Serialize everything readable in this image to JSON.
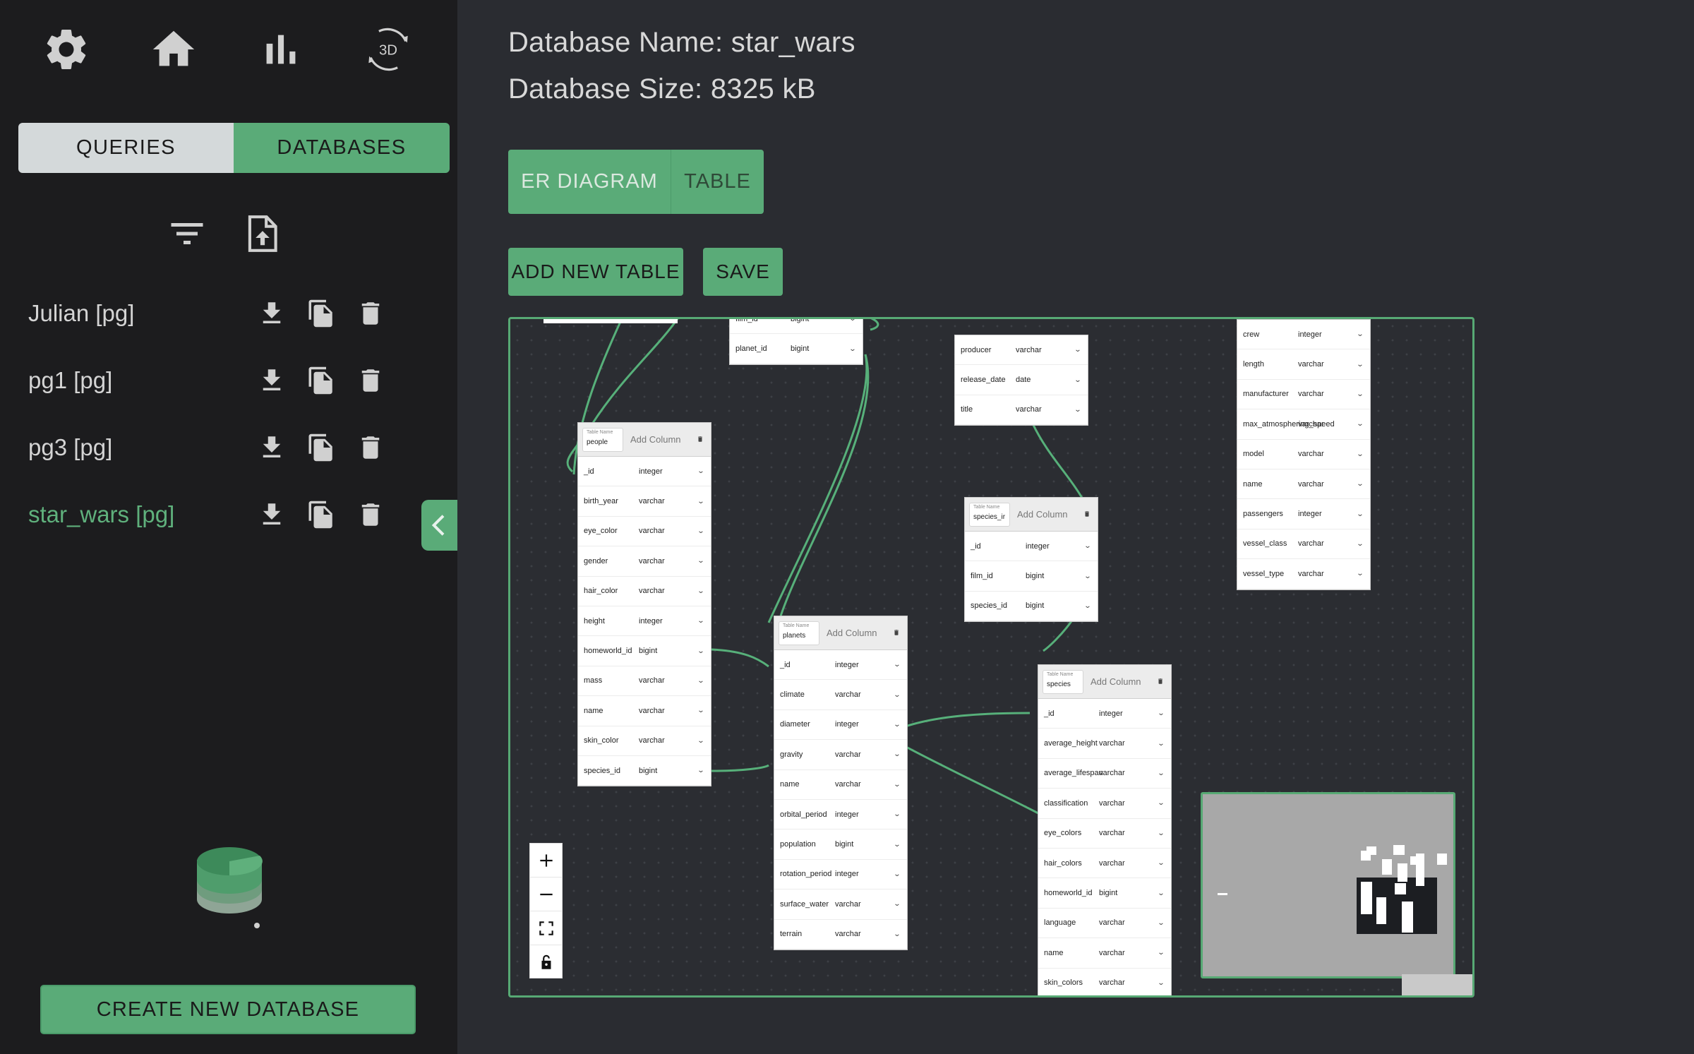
{
  "sidebar": {
    "nav": [
      {
        "icon": "gear-icon"
      },
      {
        "icon": "home-icon"
      },
      {
        "icon": "bar-chart-icon"
      },
      {
        "icon": "rotate-3d-icon",
        "label": "3D"
      }
    ],
    "tabs": {
      "queries": "QUERIES",
      "databases": "DATABASES",
      "active": "databases"
    },
    "tools": [
      {
        "icon": "filter-icon"
      },
      {
        "icon": "upload-file-icon"
      }
    ],
    "databases": [
      {
        "name": "Julian [pg]",
        "active": false
      },
      {
        "name": "pg1 [pg]",
        "active": false
      },
      {
        "name": "pg3 [pg]",
        "active": false
      },
      {
        "name": "star_wars [pg]",
        "active": true
      }
    ],
    "create_button": "CREATE NEW DATABASE"
  },
  "main": {
    "db_name": "Database Name: star_wars",
    "db_size": "Database Size: 8325 kB",
    "view_toggle": {
      "er": "ER DIAGRAM",
      "table": "TABLE",
      "active": "er"
    },
    "add_table": "ADD NEW TABLE",
    "save": "SAVE"
  },
  "er": {
    "add_column_label": "Add Column",
    "tables": [
      {
        "id": "films-planets",
        "name": "",
        "rows": [
          [
            "film_id",
            "bigint"
          ],
          [
            "planet_id",
            "bigint"
          ]
        ]
      },
      {
        "id": "films",
        "name": "",
        "rows": [
          [
            "producer",
            "varchar"
          ],
          [
            "release_date",
            "date"
          ],
          [
            "title",
            "varchar"
          ]
        ]
      },
      {
        "id": "starships",
        "name": "",
        "rows": [
          [
            "crew",
            "integer"
          ],
          [
            "length",
            "varchar"
          ],
          [
            "manufacturer",
            "varchar"
          ],
          [
            "max_atmosphering_speed",
            "varchar"
          ],
          [
            "model",
            "varchar"
          ],
          [
            "name",
            "varchar"
          ],
          [
            "passengers",
            "integer"
          ],
          [
            "vessel_class",
            "varchar"
          ],
          [
            "vessel_type",
            "varchar"
          ]
        ]
      },
      {
        "id": "people",
        "name": "people",
        "rows": [
          [
            "_id",
            "integer"
          ],
          [
            "birth_year",
            "varchar"
          ],
          [
            "eye_color",
            "varchar"
          ],
          [
            "gender",
            "varchar"
          ],
          [
            "hair_color",
            "varchar"
          ],
          [
            "height",
            "integer"
          ],
          [
            "homeworld_id",
            "bigint"
          ],
          [
            "mass",
            "varchar"
          ],
          [
            "name",
            "varchar"
          ],
          [
            "skin_color",
            "varchar"
          ],
          [
            "species_id",
            "bigint"
          ]
        ]
      },
      {
        "id": "species-in-films",
        "name": "species_ir",
        "rows": [
          [
            "_id",
            "integer"
          ],
          [
            "film_id",
            "bigint"
          ],
          [
            "species_id",
            "bigint"
          ]
        ]
      },
      {
        "id": "planets",
        "name": "planets",
        "rows": [
          [
            "_id",
            "integer"
          ],
          [
            "climate",
            "varchar"
          ],
          [
            "diameter",
            "integer"
          ],
          [
            "gravity",
            "varchar"
          ],
          [
            "name",
            "varchar"
          ],
          [
            "orbital_period",
            "integer"
          ],
          [
            "population",
            "bigint"
          ],
          [
            "rotation_period",
            "integer"
          ],
          [
            "surface_water",
            "varchar"
          ],
          [
            "terrain",
            "varchar"
          ]
        ]
      },
      {
        "id": "species",
        "name": "species",
        "rows": [
          [
            "_id",
            "integer"
          ],
          [
            "average_height",
            "varchar"
          ],
          [
            "average_lifespan",
            "varchar"
          ],
          [
            "classification",
            "varchar"
          ],
          [
            "eye_colors",
            "varchar"
          ],
          [
            "hair_colors",
            "varchar"
          ],
          [
            "homeworld_id",
            "bigint"
          ],
          [
            "language",
            "varchar"
          ],
          [
            "name",
            "varchar"
          ],
          [
            "skin_colors",
            "varchar"
          ]
        ]
      }
    ]
  },
  "colors": {
    "accent": "#5aab78",
    "sidebar_bg": "#1c1c1e",
    "main_bg": "#2a2c31",
    "active_db": "#5fb07c"
  }
}
